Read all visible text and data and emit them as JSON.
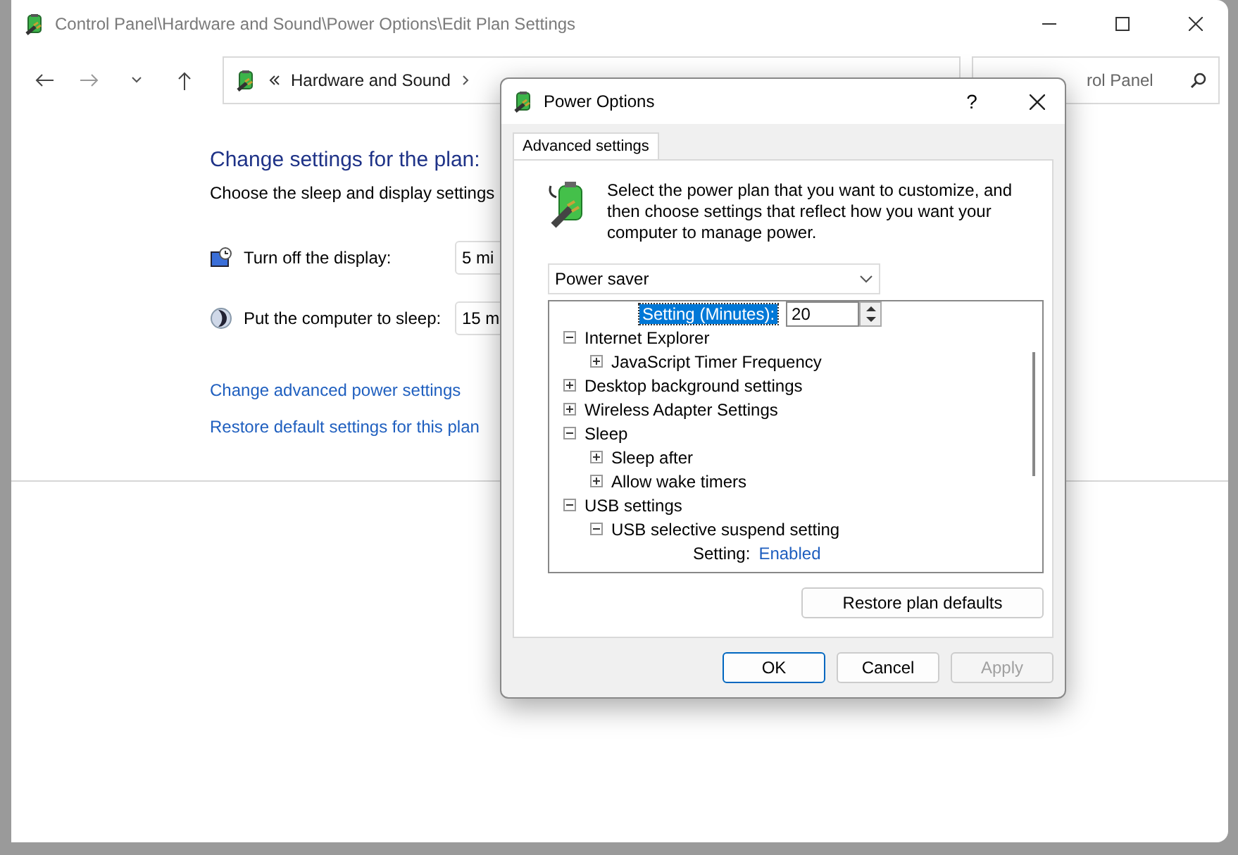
{
  "window": {
    "title": "Control Panel\\Hardware and Sound\\Power Options\\Edit Plan Settings"
  },
  "address_bar": {
    "items": [
      "Hardware and Sound"
    ]
  },
  "search": {
    "placeholder": "rol Panel"
  },
  "content": {
    "heading": "Change settings for the plan:",
    "subtitle": "Choose the sleep and display settings",
    "settings": [
      {
        "kind": "display",
        "label": "Turn off the display:",
        "value": "5 mi"
      },
      {
        "kind": "sleep",
        "label": "Put the computer to sleep:",
        "value": "15 m"
      }
    ],
    "links": [
      "Change advanced power settings",
      "Restore default settings for this plan"
    ]
  },
  "dialog": {
    "title": "Power Options",
    "help": "?",
    "tabs": [
      {
        "label": "Advanced settings",
        "selected": true
      }
    ],
    "description": "Select the power plan that you want to customize, and then choose settings that reflect how you want your computer to manage power.",
    "plan": "Power saver",
    "tree": [
      {
        "kind": "spinner",
        "label": "Setting (Minutes):",
        "value": "20",
        "selected": true
      },
      {
        "kind": "group",
        "label": "Internet Explorer",
        "expanded": true,
        "children": [
          {
            "kind": "group",
            "label": "JavaScript Timer Frequency",
            "expanded": false
          }
        ]
      },
      {
        "kind": "group",
        "label": "Desktop background settings",
        "expanded": false
      },
      {
        "kind": "group",
        "label": "Wireless Adapter Settings",
        "expanded": false
      },
      {
        "kind": "group",
        "label": "Sleep",
        "expanded": true,
        "children": [
          {
            "kind": "group",
            "label": "Sleep after",
            "expanded": false
          },
          {
            "kind": "group",
            "label": "Allow wake timers",
            "expanded": false
          }
        ]
      },
      {
        "kind": "group",
        "label": "USB settings",
        "expanded": true,
        "children": [
          {
            "kind": "group",
            "label": "USB selective suspend setting",
            "expanded": true,
            "children": [
              {
                "kind": "setting",
                "label": "Setting:",
                "value": "Enabled",
                "selected": false
              }
            ]
          }
        ]
      }
    ],
    "restore_button": "Restore plan defaults",
    "buttons": [
      {
        "label": "OK",
        "disabled": false,
        "default": true
      },
      {
        "label": "Cancel",
        "disabled": false,
        "default": false
      },
      {
        "label": "Apply",
        "disabled": true,
        "default": false
      }
    ]
  }
}
